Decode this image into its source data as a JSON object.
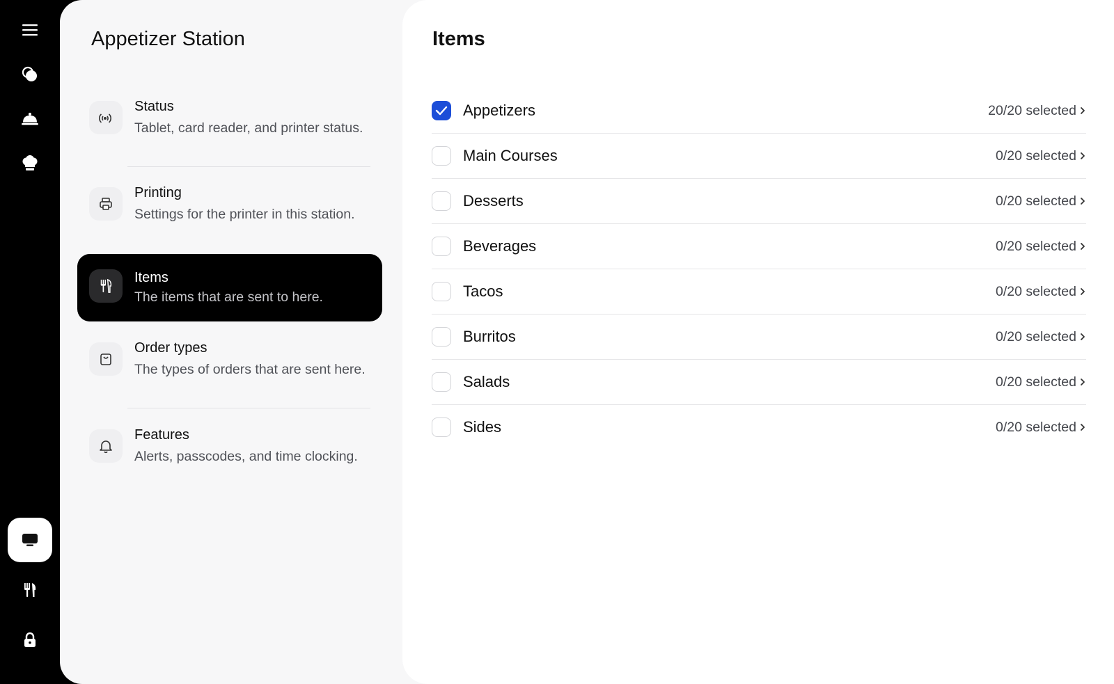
{
  "rail": {
    "items": [
      {
        "icon": "menu-icon"
      },
      {
        "icon": "shapes-icon"
      },
      {
        "icon": "cloche-icon"
      },
      {
        "icon": "chef-hat-icon"
      },
      {
        "icon": "kitchen-display-icon",
        "active": true
      },
      {
        "icon": "utensils-icon"
      },
      {
        "icon": "lock-icon"
      }
    ]
  },
  "settings": {
    "title": "Appetizer Station",
    "menu": [
      {
        "title": "Status",
        "description": "Tablet, card reader, and printer status.",
        "icon": "signal-icon"
      },
      {
        "title": "Printing",
        "description": "Settings for the printer in this station.",
        "icon": "printer-icon"
      },
      {
        "title": "Items",
        "description": "The items that are sent to here.",
        "icon": "utensils-icon",
        "active": true
      },
      {
        "title": "Order types",
        "description": "The types of orders that are sent here.",
        "icon": "bag-icon"
      },
      {
        "title": "Features",
        "description": "Alerts, passcodes, and time clocking.",
        "icon": "bell-icon"
      }
    ]
  },
  "items": {
    "title": "Items",
    "rows": [
      {
        "name": "Appetizers",
        "count": "20/20 selected",
        "checked": true
      },
      {
        "name": "Main Courses",
        "count": "0/20 selected",
        "checked": false
      },
      {
        "name": "Desserts",
        "count": "0/20 selected",
        "checked": false
      },
      {
        "name": "Beverages",
        "count": "0/20 selected",
        "checked": false
      },
      {
        "name": "Tacos",
        "count": "0/20 selected",
        "checked": false
      },
      {
        "name": "Burritos",
        "count": "0/20 selected",
        "checked": false
      },
      {
        "name": "Salads",
        "count": "0/20 selected",
        "checked": false
      },
      {
        "name": "Sides",
        "count": "0/20 selected",
        "checked": false
      }
    ]
  },
  "colors": {
    "accent": "#1c4ed8",
    "rail": "#000000",
    "panel": "#f7f7f8"
  }
}
